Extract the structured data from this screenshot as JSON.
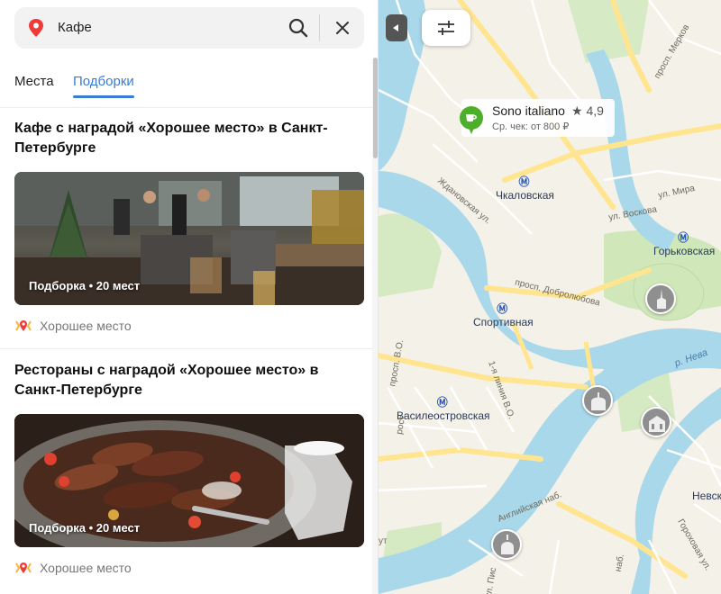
{
  "search": {
    "query": "Кафе",
    "pin_icon": "map-pin-icon",
    "search_icon": "search-icon",
    "close_icon": "close-icon"
  },
  "tabs": [
    {
      "label": "Места",
      "active": false
    },
    {
      "label": "Подборки",
      "active": true
    }
  ],
  "collections": [
    {
      "title": "Кафе с наградой «Хорошее место» в Санкт-Петербурге",
      "caption": "Подборка • 20 мест",
      "award": "Хорошее место"
    },
    {
      "title": "Рестораны с наградой «Хорошее место» в Санкт-Петербурге",
      "caption": "Подборка • 20 мест",
      "award": "Хорошее место"
    }
  ],
  "map": {
    "poi": {
      "name": "Sono italiano",
      "rating": "★ 4,9",
      "check": "Ср. чек: от 800 ₽"
    },
    "metro": [
      {
        "name": "Чкаловская"
      },
      {
        "name": "Горьковская"
      },
      {
        "name": "Спортивная"
      },
      {
        "name": "Василеостровская"
      },
      {
        "name": "Невск"
      }
    ],
    "streets": {
      "zhdanovskaya": "Ждановская ул.",
      "vosstaniya": "ул. Воскова",
      "mira": "ул. Мира",
      "dobrolyubova": "просп. Добролюбова",
      "merkova": "просп. Мерков",
      "sredniy": "просп. В.О.",
      "liniya": "1-я линия В.О.",
      "english": "Английская наб.",
      "gorokhovaya": "Гороховая ул.",
      "pisareva": "ул. Пис",
      "novo": "рост.",
      "nab": "наб.",
      "put": "ут"
    },
    "water": {
      "neva": "р. Нева"
    },
    "colors": {
      "accent": "#3a7bd5",
      "water": "#a8d8ea",
      "road_major": "#fff1b0",
      "park": "#cfe7b9",
      "poi_badge": "#4caf2a"
    }
  }
}
